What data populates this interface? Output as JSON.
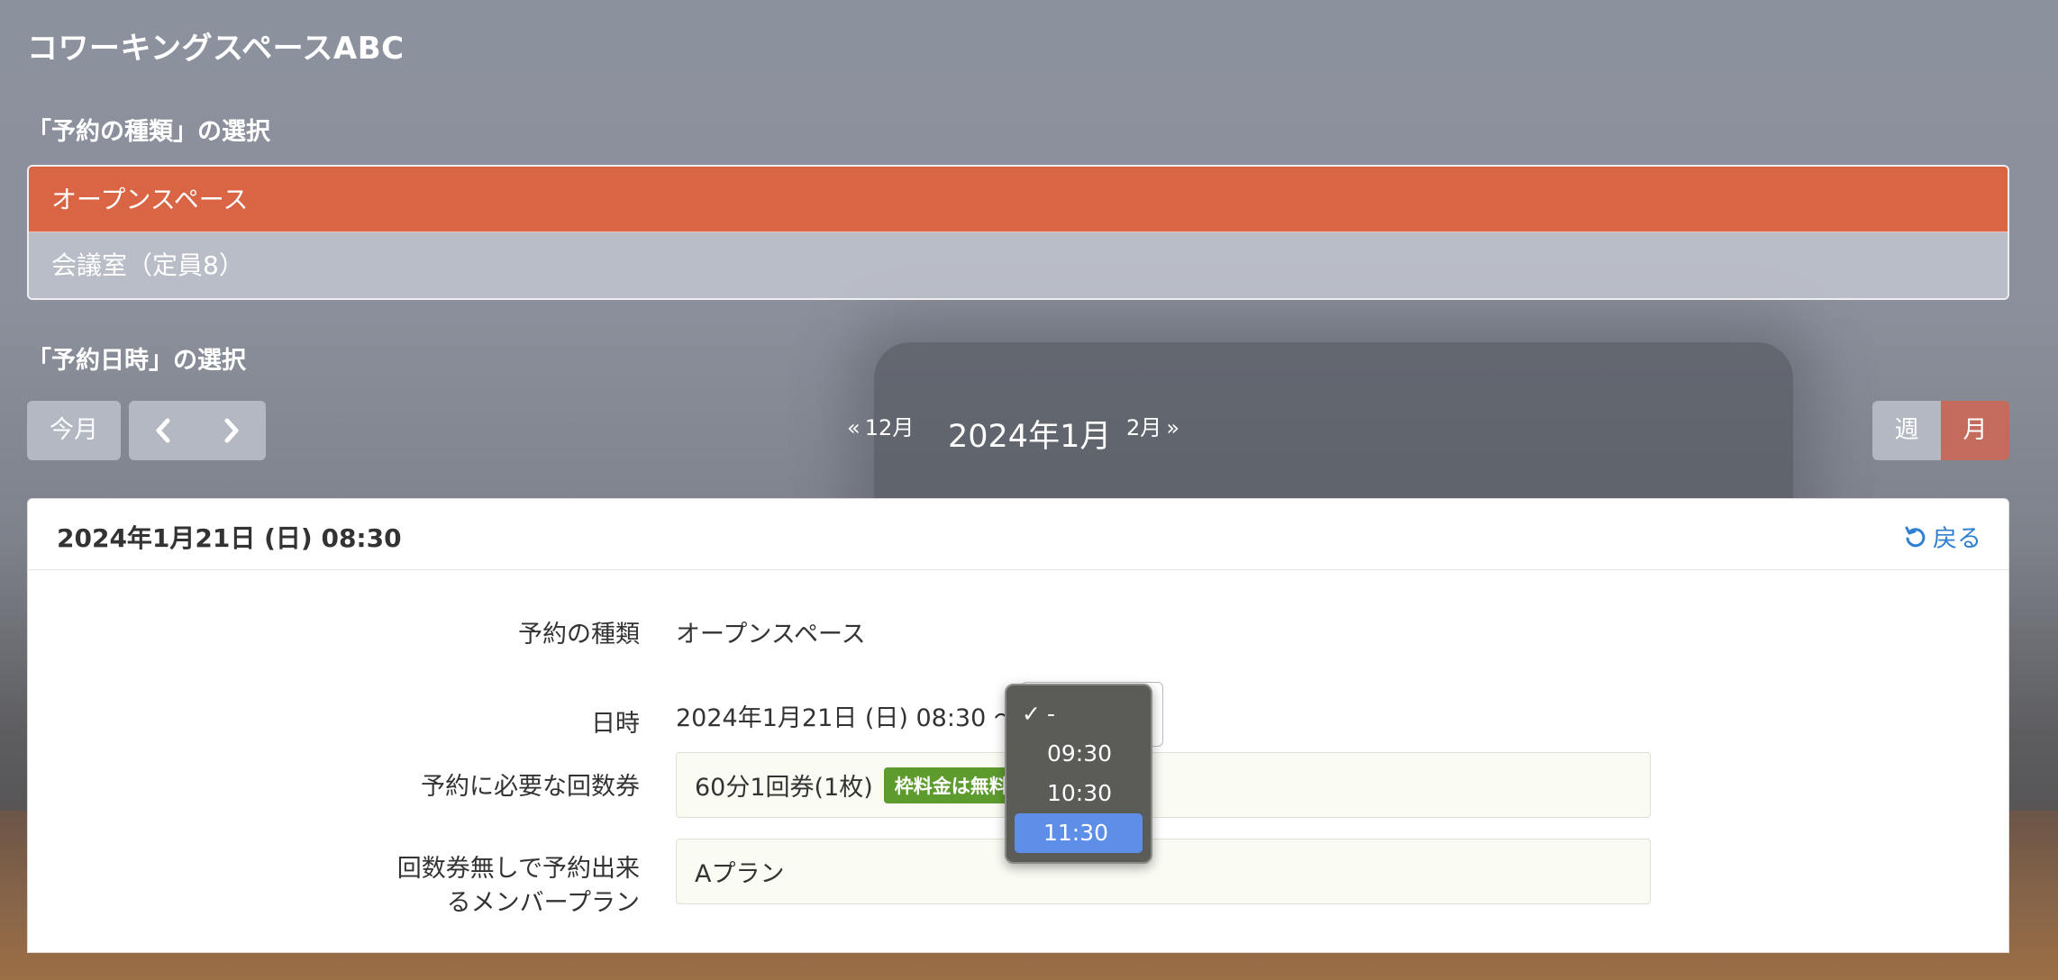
{
  "brand": "コワーキングスペースABC",
  "type_section": {
    "title": "「予約の種類」の選択",
    "items": [
      {
        "label": "オープンスペース",
        "active": true
      },
      {
        "label": "会議室（定員8）",
        "active": false
      }
    ]
  },
  "date_section": {
    "title": "「予約日時」の選択",
    "today_label": "今月",
    "prev_month": "12月",
    "current_month": "2024年1月",
    "next_month": "2月",
    "view_week": "週",
    "view_month": "月"
  },
  "detail": {
    "title": "2024年1月21日 (日) 08:30",
    "back_label": "戻る",
    "rows": {
      "type_label": "予約の種類",
      "type_value": "オープンスペース",
      "datetime_label": "日時",
      "datetime_value": "2024年1月21日 (日) 08:30 ～",
      "ticket_label": "予約に必要な回数券",
      "ticket_value": "60分1回券(1枚)",
      "ticket_badge": "枠料金は無料",
      "plan_label_line1": "回数券無しで予約出来",
      "plan_label_line2": "るメンバープラン",
      "plan_value": "Aプラン"
    },
    "end_time_dropdown": {
      "options": [
        "-",
        "09:30",
        "10:30",
        "11:30"
      ],
      "checked": "-",
      "highlighted": "11:30"
    }
  },
  "colors": {
    "accent": "#d96545",
    "link": "#2f80d0",
    "badge": "#5d9b2f",
    "dropdown_highlight": "#5d8fe9"
  }
}
